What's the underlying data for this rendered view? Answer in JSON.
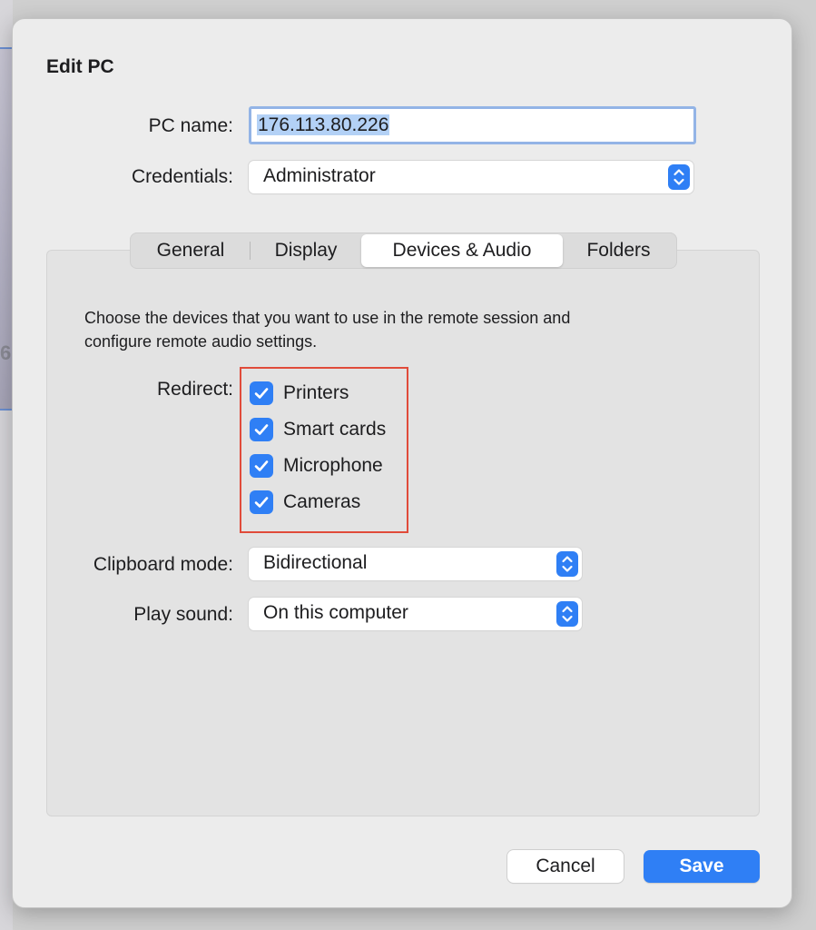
{
  "dialog": {
    "title": "Edit PC"
  },
  "form": {
    "pc_name_label": "PC name:",
    "pc_name_value": "176.113.80.226",
    "credentials_label": "Credentials:",
    "credentials_value": "Administrator"
  },
  "tabs": [
    {
      "label": "General",
      "selected": false
    },
    {
      "label": "Display",
      "selected": false
    },
    {
      "label": "Devices & Audio",
      "selected": true
    },
    {
      "label": "Folders",
      "selected": false
    }
  ],
  "devices_audio": {
    "description_line1": "Choose the devices that you want to use in the remote session and",
    "description_line2": "configure remote audio settings.",
    "redirect_label": "Redirect:",
    "redirect_items": [
      {
        "label": "Printers",
        "checked": true
      },
      {
        "label": "Smart cards",
        "checked": true
      },
      {
        "label": "Microphone",
        "checked": true
      },
      {
        "label": "Cameras",
        "checked": true
      }
    ],
    "clipboard_label": "Clipboard mode:",
    "clipboard_value": "Bidirectional",
    "play_sound_label": "Play sound:",
    "play_sound_value": "On this computer"
  },
  "buttons": {
    "cancel_label": "Cancel",
    "save_label": "Save"
  },
  "background": {
    "partial_text": "6"
  },
  "colors": {
    "accent": "#2f7ff5",
    "highlight_border": "#e04b3a",
    "sheet_bg": "#ececec"
  }
}
